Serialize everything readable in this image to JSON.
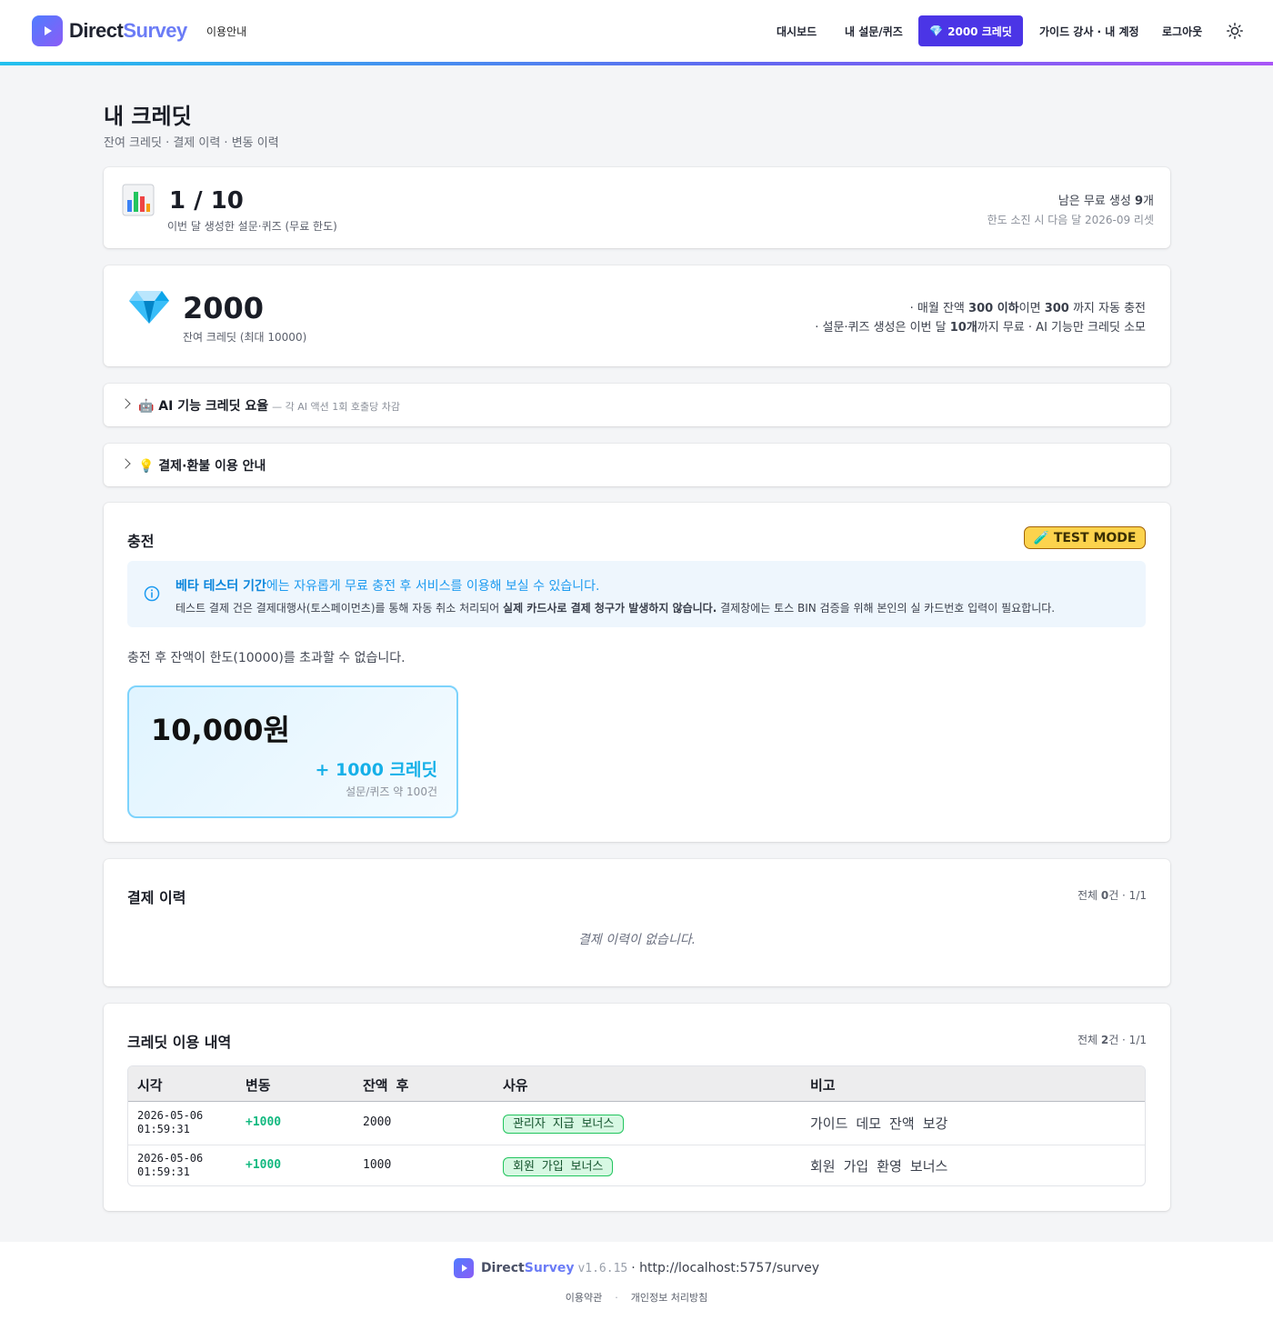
{
  "header": {
    "brand_a": "Direct",
    "brand_b": "Survey",
    "guide_link": "이용안내",
    "nav": [
      "대시보드",
      "내 설문/퀴즈",
      "가이드 강사 · 내 계정",
      "로그아웃"
    ],
    "credit_button": "2000 크레딧",
    "icons": [
      "play-icon",
      "gem-icon",
      "sun-icon"
    ]
  },
  "page": {
    "title": "내 크레딧",
    "subtitle": "잔여 크레딧 · 결제 이력 · 변동 이력"
  },
  "usage": {
    "count": "1 / 10",
    "note": "이번 달 생성한 설문·퀴즈 (무료 한도)",
    "remaining_prefix": "남은 무료 생성 ",
    "remaining_value": "9",
    "remaining_suffix": "개",
    "reset_note": "한도 소진 시 다음 달 2026-09 리셋"
  },
  "balance": {
    "amount": "2000",
    "note": "잔여 크레딧 (최대 10000)",
    "rule1_a": "· 매월 잔액 ",
    "rule1_b": "300 이하",
    "rule1_c": "이면 ",
    "rule1_d": "300",
    "rule1_e": " 까지 자동 충전",
    "rule2_a": "· 설문·퀴즈 생성은 이번 달 ",
    "rule2_b": "10개",
    "rule2_c": "까지 무료 · AI 기능만 크레딧 소모"
  },
  "collapsibles": {
    "ai_title": "🤖 AI 기능 크레딧 요율",
    "ai_sub": "— 각 AI 액션 1회 호출당 차감",
    "refund_title": "💡 결제·환불 이용 안내"
  },
  "charge": {
    "title": "충전",
    "badge": "🧪 TEST MODE",
    "info_bold": "베타 테스터 기간",
    "info_rest": "에는 자유롭게 무료 충전 후 서비스를 이용해 보실 수 있습니다.",
    "info2_a": "테스트 결제 건은 결제대행사(토스페이먼츠)를 통해 자동 취소 처리되어 ",
    "info2_b": "실제 카드사로 결제 청구가 발생하지 않습니다.",
    "info2_c": " 결제창에는 토스 BIN 검증을 위해 본인의 실 카드번호 입력이 필요합니다.",
    "limit_note": "충전 후 잔액이 한도(10000)를 초과할 수 없습니다.",
    "package": {
      "price": "10,000원",
      "credits": "+ 1000 크레딧",
      "sub": "설문/퀴즈 약 100건"
    }
  },
  "payments": {
    "title": "결제 이력",
    "count_a": "전체 ",
    "count_b": "0",
    "count_c": "건 · 1/1",
    "empty": "결제 이력이 없습니다."
  },
  "ledger": {
    "title": "크레딧 이용 내역",
    "count_a": "전체 ",
    "count_b": "2",
    "count_c": "건 · 1/1",
    "columns": [
      "시각",
      "변동",
      "잔액 후",
      "사유",
      "비고"
    ],
    "rows": [
      {
        "date": "2026-05-06",
        "time": "01:59:31",
        "delta": "+1000",
        "balance": "2000",
        "reason": "관리자 지급 보너스",
        "note": "가이드 데모 잔액 보강"
      },
      {
        "date": "2026-05-06",
        "time": "01:59:31",
        "delta": "+1000",
        "balance": "1000",
        "reason": "회원 가입 보너스",
        "note": "회원 가입 환영 보너스"
      }
    ]
  },
  "footer": {
    "brand_a": "Direct",
    "brand_b": "Survey",
    "version": "v1.6.15",
    "url": "· http://localhost:5757/survey",
    "links": [
      "이용약관",
      "개인정보 처리방침"
    ]
  },
  "colors": {
    "accent": "#4b35e6",
    "brand_gradient_start": "#4f7cff",
    "brand_gradient_end": "#8b5cf6",
    "success": "#13b980",
    "info": "#1d9bf0",
    "warning": "#fcd34d"
  }
}
